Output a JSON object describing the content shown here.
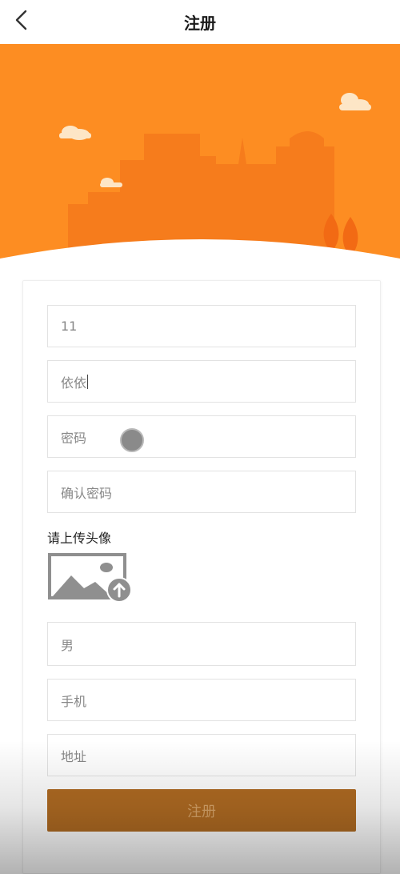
{
  "header": {
    "title": "注册"
  },
  "form": {
    "username_value": "11",
    "nickname_value": "依依",
    "password_placeholder": "密码",
    "confirm_password_placeholder": "确认密码",
    "avatar_label": "请上传头像",
    "gender_value": "男",
    "phone_placeholder": "手机",
    "address_placeholder": "地址",
    "submit_label": "注册"
  },
  "colors": {
    "banner_orange": "#fd8d22",
    "building": "#f57a1c",
    "submit": "#b06b22"
  }
}
